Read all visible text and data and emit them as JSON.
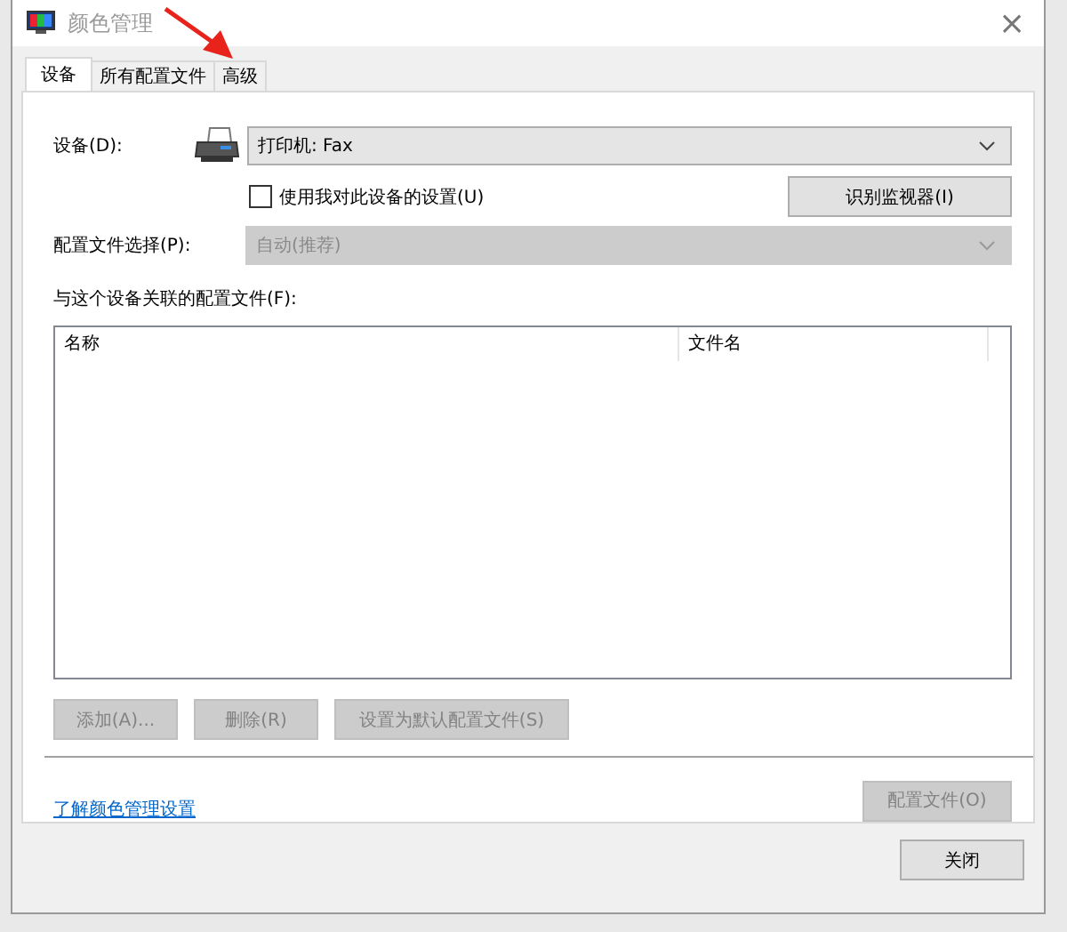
{
  "window": {
    "title": "颜色管理",
    "close": "×"
  },
  "tabs": [
    {
      "label": "设备",
      "selected": true
    },
    {
      "label": "所有配置文件",
      "selected": false
    },
    {
      "label": "高级",
      "selected": false
    }
  ],
  "device": {
    "label": "设备(D):",
    "value": "打印机: Fax"
  },
  "use_my_settings": {
    "label": "使用我对此设备的设置(U)",
    "checked": false
  },
  "identify_button": {
    "label": "识别监视器(I)",
    "disabled": false
  },
  "profile_selection": {
    "label": "配置文件选择(P):",
    "value": "自动(推荐)",
    "disabled": true
  },
  "profiles_label": "与这个设备关联的配置文件(F):",
  "table": {
    "columns": [
      "名称",
      "文件名"
    ]
  },
  "list_buttons": [
    {
      "label": "添加(A)...",
      "disabled": true
    },
    {
      "label": "删除(R)",
      "disabled": true
    }
  ],
  "default_button": {
    "label": "设置为默认配置文件(S)",
    "disabled": true
  },
  "link": "了解颜色管理设置",
  "profiles_button": {
    "label": "配置文件(O)",
    "disabled": true
  },
  "close_button": {
    "label": "关闭"
  }
}
